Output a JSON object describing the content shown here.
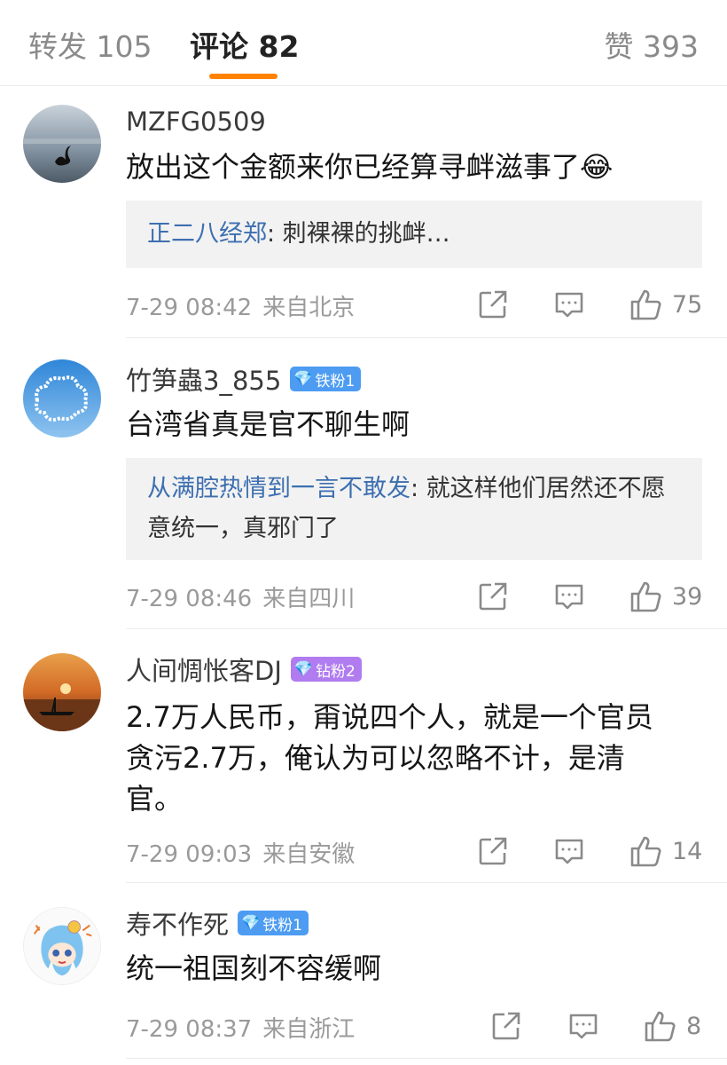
{
  "tabs": {
    "repost": "转发 105",
    "comment": "评论 82",
    "like": "赞 393"
  },
  "comments": [
    {
      "username": "MZFG0509",
      "text": "放出这个金额来你已经算寻衅滋事了😂",
      "quote_user": "正二八经郑",
      "quote_text": ": 刺裸裸的挑衅…",
      "time": "7-29 08:42",
      "location": "来自北京",
      "likes": "75"
    },
    {
      "username": "竹笋蟲3_855",
      "badge": "铁粉1",
      "text": "台湾省真是官不聊生啊",
      "quote_user": "从满腔热情到一言不敢发",
      "quote_text": ": 就这样他们居然还不愿意统一，真邪门了",
      "time": "7-29 08:46",
      "location": "来自四川",
      "likes": "39"
    },
    {
      "username": "人间惆怅客DJ",
      "badge": "钻粉2",
      "text": "2.7万人民币，甭说四个人，就是一个官员贪污2.7万，俺认为可以忽略不计，是清官。",
      "time": "7-29 09:03",
      "location": "来自安徽",
      "likes": "14"
    },
    {
      "username": "寿不作死",
      "badge": "铁粉1",
      "text": "统一祖国刻不容缓啊",
      "time": "7-29 08:37",
      "location": "来自浙江",
      "likes": "8"
    }
  ],
  "colors": {
    "accent": "#ff8200",
    "link": "#3d6fb0",
    "iron_badge": "#4d9cf2",
    "diamond_badge": "#b07cf0"
  },
  "icons": [
    "share-icon",
    "comment-icon",
    "thumbs-up-icon",
    "gem-icon"
  ]
}
